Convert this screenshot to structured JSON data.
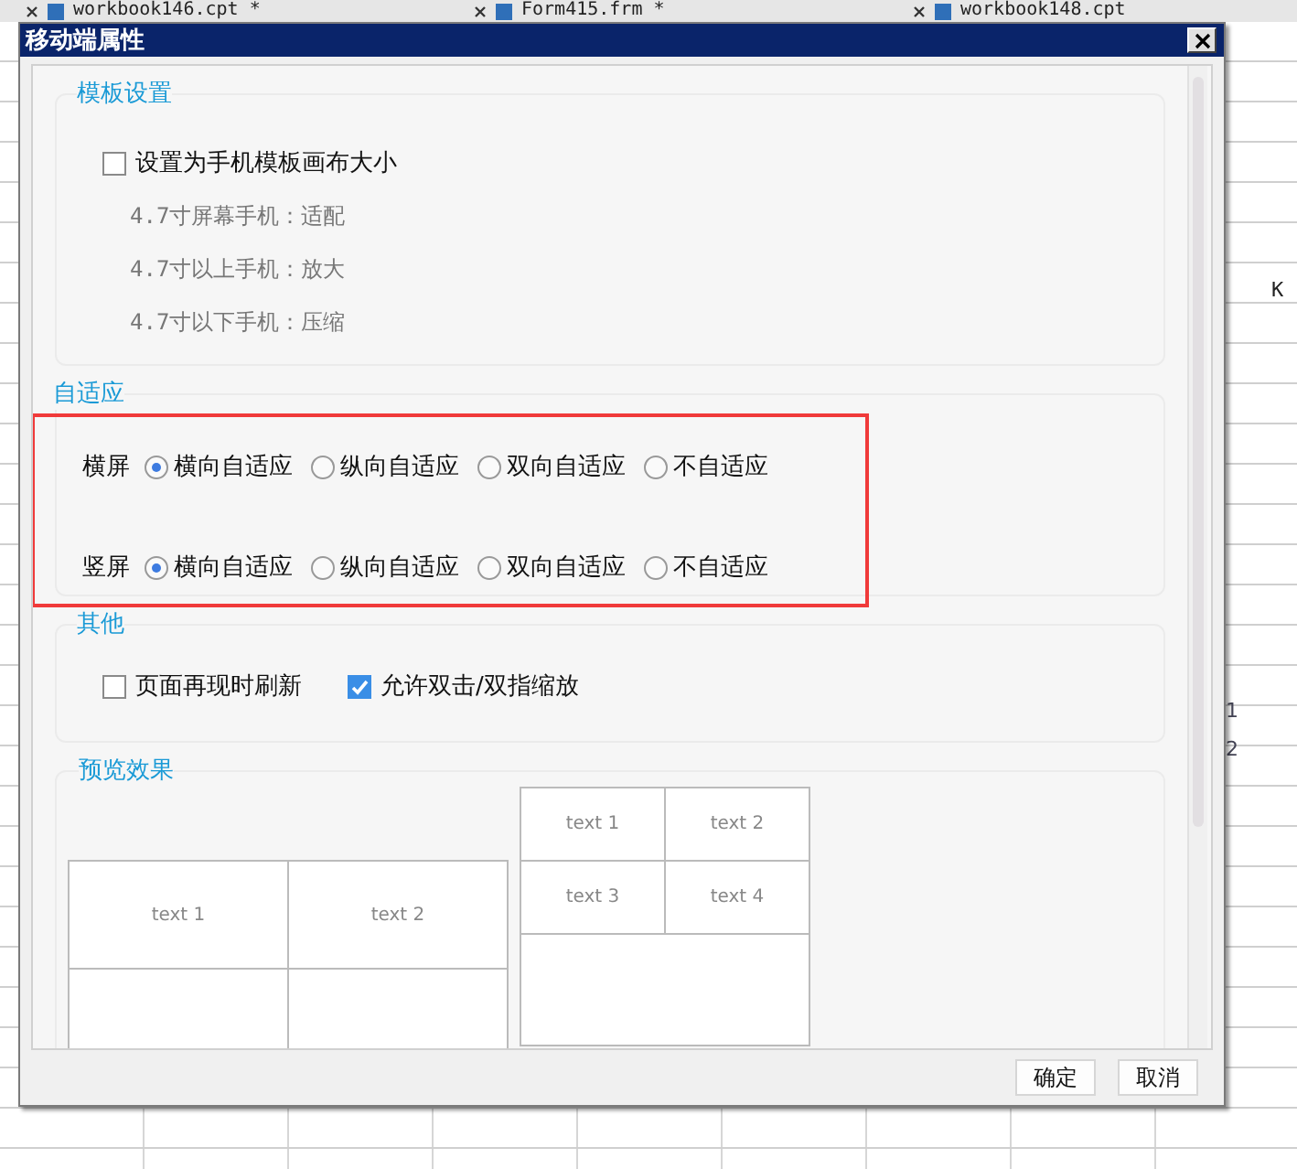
{
  "background": {
    "tabs": [
      {
        "label": "workbook146.cpt *"
      },
      {
        "label": "Form415.frm *"
      },
      {
        "label": "workbook148.cpt"
      }
    ],
    "column_header": "K",
    "row_numbers": [
      "1",
      "2"
    ]
  },
  "dialog": {
    "title": "移动端属性",
    "sections": [
      {
        "kind": "template",
        "title": "模板设置",
        "checkbox": {
          "label": "设置为手机模板画布大小",
          "checked": false
        },
        "notes": [
          "4.7寸屏幕手机：适配",
          "4.7寸以上手机：放大",
          "4.7寸以下手机：压缩"
        ]
      },
      {
        "kind": "adaptive",
        "title": "自适应",
        "rows": [
          {
            "label": "横屏",
            "options": [
              {
                "label": "横向自适应",
                "selected": true
              },
              {
                "label": "纵向自适应",
                "selected": false
              },
              {
                "label": "双向自适应",
                "selected": false
              },
              {
                "label": "不自适应",
                "selected": false
              }
            ]
          },
          {
            "label": "竖屏",
            "options": [
              {
                "label": "横向自适应",
                "selected": true
              },
              {
                "label": "纵向自适应",
                "selected": false
              },
              {
                "label": "双向自适应",
                "selected": false
              },
              {
                "label": "不自适应",
                "selected": false
              }
            ]
          }
        ]
      },
      {
        "kind": "other",
        "title": "其他",
        "checkboxes": [
          {
            "label": "页面再现时刷新",
            "checked": false
          },
          {
            "label": "允许双击/双指缩放",
            "checked": true
          }
        ]
      },
      {
        "kind": "preview",
        "title": "预览效果",
        "tables": [
          {
            "rows": [
              [
                "text 1",
                "text 2"
              ]
            ]
          },
          {
            "rows": [
              [
                "text 1",
                "text 2"
              ],
              [
                "text 3",
                "text 4"
              ]
            ]
          }
        ]
      }
    ],
    "buttons": [
      "确定",
      "取消"
    ]
  }
}
